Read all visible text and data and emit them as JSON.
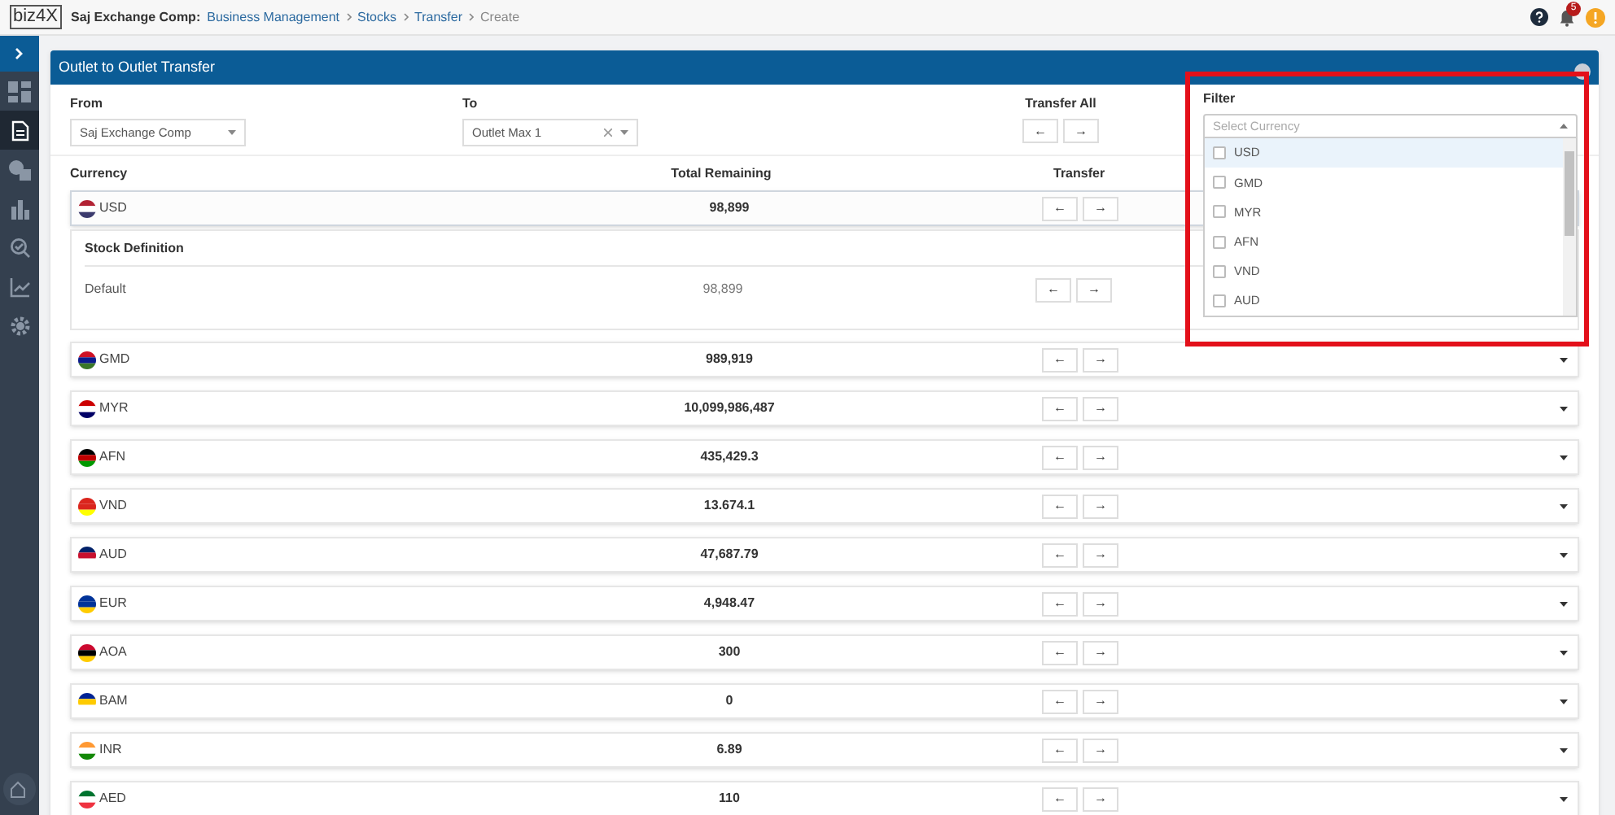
{
  "breadcrumb": {
    "company": "Saj Exchange Comp:",
    "items": [
      "Business Management",
      "Stocks",
      "Transfer",
      "Create"
    ]
  },
  "logo": "biz4X",
  "notifications": {
    "count": "5"
  },
  "sidebar": {
    "items": [
      {
        "selected": false
      },
      {
        "selected": true
      },
      {
        "selected": false
      },
      {
        "selected": false
      },
      {
        "selected": false
      },
      {
        "selected": false
      },
      {
        "selected": false
      }
    ]
  },
  "card": {
    "title": "Outlet to Outlet Transfer"
  },
  "form": {
    "from_label": "From",
    "from_value": "Saj Exchange Comp",
    "to_label": "To",
    "to_value": "Outlet Max 1",
    "transfer_all_label": "Transfer All",
    "left_arrow": "←",
    "right_arrow": "→"
  },
  "filter": {
    "label": "Filter",
    "placeholder": "Select Currency",
    "options": [
      {
        "label": "USD",
        "checked": false,
        "highlighted": true
      },
      {
        "label": "GMD",
        "checked": false,
        "highlighted": false
      },
      {
        "label": "MYR",
        "checked": false,
        "highlighted": false
      },
      {
        "label": "AFN",
        "checked": false,
        "highlighted": false
      },
      {
        "label": "VND",
        "checked": false,
        "highlighted": false
      },
      {
        "label": "AUD",
        "checked": false,
        "highlighted": false
      }
    ]
  },
  "table": {
    "columns": [
      "Currency",
      "Total Remaining",
      "Transfer"
    ],
    "rows": [
      {
        "currency": "USD",
        "total": "98,899",
        "expanded": true,
        "detail": {
          "heading": "Stock Definition",
          "rows": [
            {
              "name": "Default",
              "total": "98,899"
            }
          ]
        }
      },
      {
        "currency": "GMD",
        "total": "989,919",
        "expanded": false
      },
      {
        "currency": "MYR",
        "total": "10,099,986,487",
        "expanded": false
      },
      {
        "currency": "AFN",
        "total": "435,429.3",
        "expanded": false
      },
      {
        "currency": "VND",
        "total": "13.674.1",
        "expanded": false
      },
      {
        "currency": "AUD",
        "total": "47,687.79",
        "expanded": false
      },
      {
        "currency": "EUR",
        "total": "4,948.47",
        "expanded": false
      },
      {
        "currency": "AOA",
        "total": "300",
        "expanded": false
      },
      {
        "currency": "BAM",
        "total": "0",
        "expanded": false
      },
      {
        "currency": "INR",
        "total": "6.89",
        "expanded": false
      },
      {
        "currency": "AED",
        "total": "110",
        "expanded": false
      }
    ]
  }
}
